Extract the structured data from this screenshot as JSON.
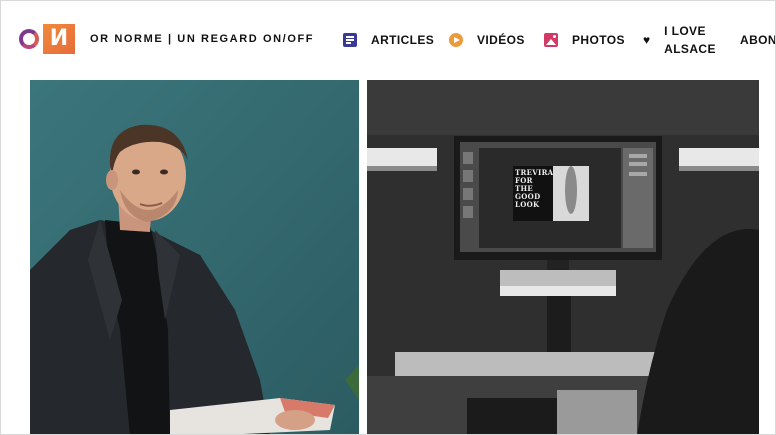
{
  "brand": {
    "logo_letters": "ON",
    "tagline": "OR NORME | UN REGARD ON/OFF"
  },
  "nav": {
    "items": [
      {
        "label": "ARTICLES",
        "icon": "articles-icon",
        "color": "#3a3a94"
      },
      {
        "label": "VIDÉOS",
        "icon": "play-circle-icon",
        "color": "#ec9a3a"
      },
      {
        "label": "PHOTOS",
        "icon": "image-icon",
        "color": "#d33966"
      },
      {
        "label_line1": "I LOVE",
        "label_line2": "ALSACE",
        "icon": "heart-icon",
        "color": "#111111"
      },
      {
        "label": "ABONN"
      }
    ]
  },
  "screen": {
    "monitor_headline_lines": [
      "TREVIRA",
      "FOR",
      "THE",
      "GOOD",
      "LOOK"
    ]
  },
  "colors": {
    "left_photo_bg": "#356d73",
    "right_photo_bg": "#2b2b2b",
    "logo_gradient_start": "#f08a3c"
  }
}
